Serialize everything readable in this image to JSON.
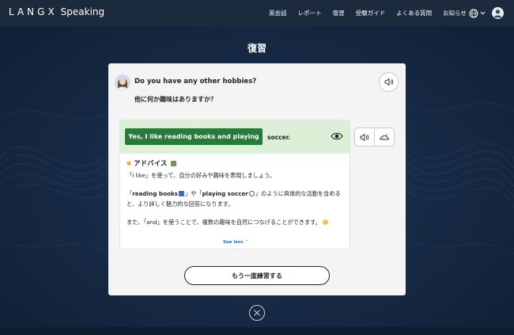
{
  "header": {
    "brand": "LANGX",
    "brand_sub": "Speaking",
    "nav": [
      "英会話",
      "レポート",
      "復習",
      "受験ガイド",
      "よくある質問",
      "お知らせ"
    ]
  },
  "page": {
    "title": "復習"
  },
  "question": {
    "english": "Do you have any other hobbies?",
    "japanese": "他に何か趣味はありますか？"
  },
  "answer": {
    "highlight": "Yes, I like reading books and playing",
    "rest": "soccer."
  },
  "advice": {
    "title": "アドバイス",
    "p1": "「I like」を使って、自分の好みや趣味を表現しましょう。",
    "p2_a": "「",
    "p2_b1": "reading books",
    "p2_c": "」や「",
    "p2_b2": "playing soccer",
    "p2_d": "」のように具体的な活動を含めると、より詳しく魅力的な回答になります。",
    "p3": "また、「and」を使うことで、複数の趣味を自然につなげることができます。",
    "see_less": "See less"
  },
  "buttons": {
    "retry": "もう一度練習する"
  },
  "colors": {
    "accent_green": "#267a3c",
    "answer_bg": "#dcefd7",
    "link": "#2a6db5",
    "bg_dark": "#14253d"
  }
}
